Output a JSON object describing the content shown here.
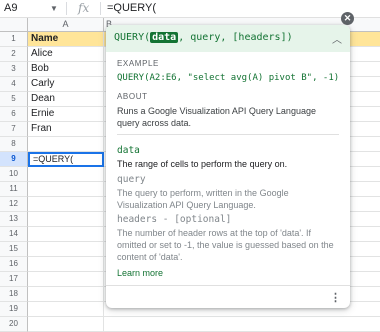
{
  "formula_bar": {
    "cell_ref": "A9",
    "fx": "fx",
    "formula": "=QUERY("
  },
  "grid": {
    "columns": [
      "A",
      "B"
    ],
    "rows": [
      {
        "num": "1",
        "a": "Name"
      },
      {
        "num": "2",
        "a": "Alice"
      },
      {
        "num": "3",
        "a": "Bob"
      },
      {
        "num": "4",
        "a": "Carly"
      },
      {
        "num": "5",
        "a": "Dean"
      },
      {
        "num": "6",
        "a": "Ernie"
      },
      {
        "num": "7",
        "a": "Fran"
      },
      {
        "num": "8",
        "a": ""
      },
      {
        "num": "9",
        "a": "=QUERY("
      },
      {
        "num": "10",
        "a": ""
      },
      {
        "num": "11",
        "a": ""
      },
      {
        "num": "12",
        "a": ""
      },
      {
        "num": "13",
        "a": ""
      },
      {
        "num": "14",
        "a": ""
      },
      {
        "num": "15",
        "a": ""
      },
      {
        "num": "16",
        "a": ""
      },
      {
        "num": "17",
        "a": ""
      },
      {
        "num": "18",
        "a": ""
      },
      {
        "num": "19",
        "a": ""
      },
      {
        "num": "20",
        "a": ""
      }
    ]
  },
  "colors": {
    "header_fill": "#ffe599",
    "selection": "#1a73e8",
    "popup_accent": "#137333",
    "popup_head_bg": "#e6f4ea"
  },
  "popup": {
    "sig_fn": "QUERY(",
    "sig_active": "data",
    "sig_rest": ", query, [headers])",
    "example_label": "EXAMPLE",
    "example": "QUERY(A2:E6, \"select avg(A) pivot B\", -1)",
    "about_label": "ABOUT",
    "about": "Runs a Google Visualization API Query Language query across data.",
    "args": [
      {
        "name": "data",
        "desc": "The range of cells to perform the query on."
      },
      {
        "name": "query",
        "desc": "The query to perform, written in the Google Visualization API Query Language."
      },
      {
        "name": "headers - [optional]",
        "desc": "The number of header rows at the top of 'data'. If omitted or set to -1, the value is guessed based on the content of 'data'."
      }
    ],
    "learn_more": "Learn more"
  }
}
